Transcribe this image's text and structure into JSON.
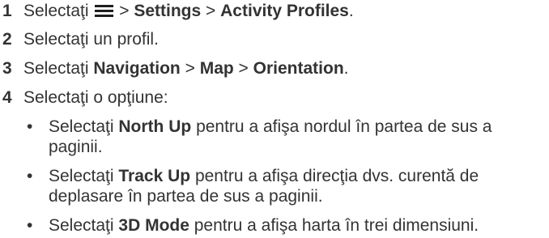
{
  "steps": [
    {
      "number": "1",
      "parts": {
        "prefix": "Selectaţi",
        "sep1": ">",
        "settings": "Settings",
        "sep2": ">",
        "activity_profiles": "Activity Profiles",
        "end": "."
      }
    },
    {
      "number": "2",
      "text": "Selectaţi un profil."
    },
    {
      "number": "3",
      "parts": {
        "prefix": "Selectaţi",
        "navigation": "Navigation",
        "sep1": ">",
        "map": "Map",
        "sep2": ">",
        "orientation": "Orientation",
        "end": "."
      }
    },
    {
      "number": "4",
      "text": "Selectaţi o opţiune:"
    }
  ],
  "options": [
    {
      "bullet": "•",
      "prefix": "Selectaţi",
      "label": "North Up",
      "text": "pentru a afişa nordul în partea de sus a paginii."
    },
    {
      "bullet": "•",
      "prefix": "Selectaţi",
      "label": "Track Up",
      "text": "pentru a afişa direcţia dvs. curentă de deplasare în partea de sus a paginii."
    },
    {
      "bullet": "•",
      "prefix": "Selectaţi",
      "label": "3D Mode",
      "text": "pentru a afişa harta în trei dimensiuni."
    }
  ],
  "icons": {
    "menu": "menu-icon"
  },
  "colors": {
    "text": "#333333",
    "icon": "#1f1f1f",
    "background": "#ffffff"
  }
}
